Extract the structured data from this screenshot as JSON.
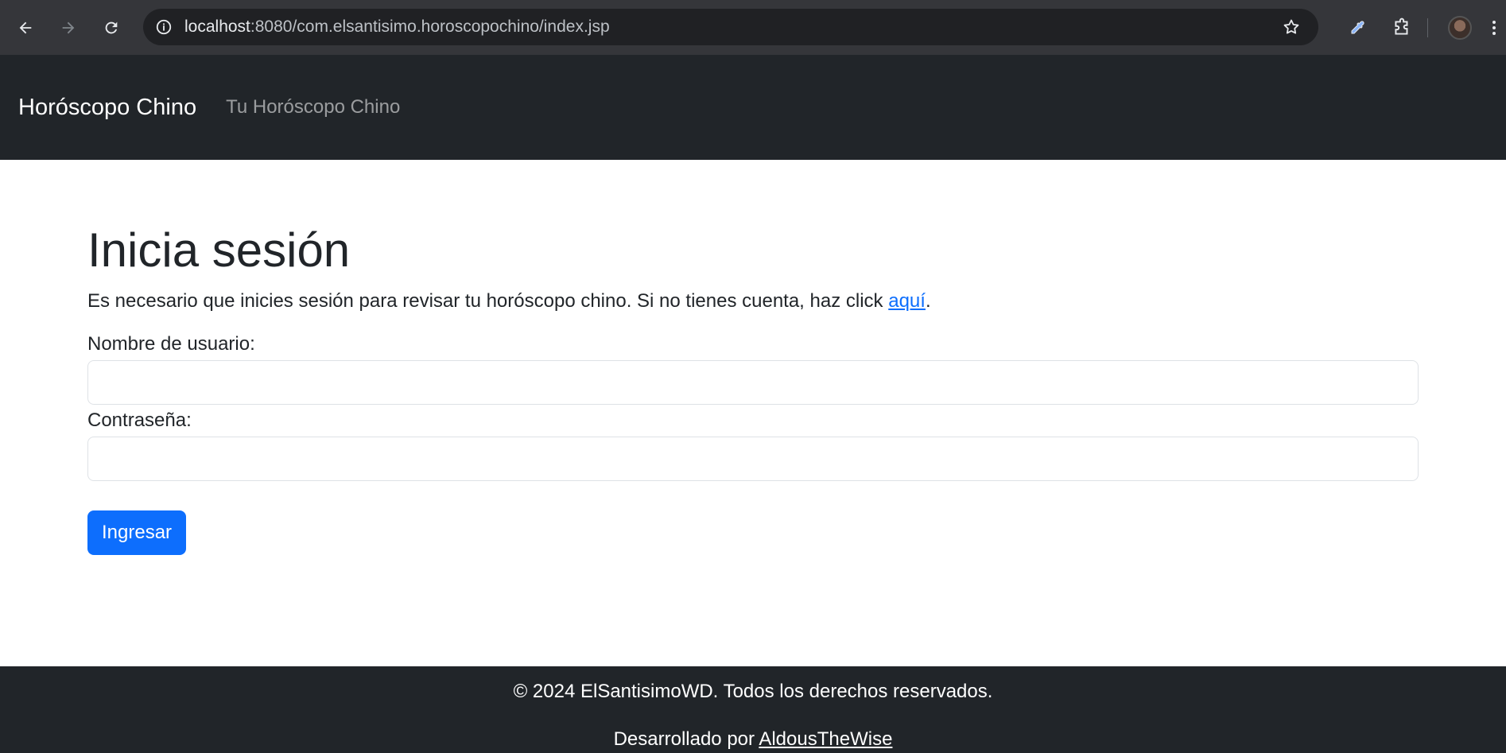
{
  "browser": {
    "url_host": "localhost",
    "url_path": ":8080/com.elsantisimo.horoscopochino/index.jsp",
    "icons": [
      "back-arrow-icon",
      "forward-arrow-icon",
      "reload-icon",
      "site-info-icon",
      "bookmark-star-icon",
      "eyedropper-icon",
      "extensions-puzzle-icon",
      "profile-avatar",
      "kebab-menu-icon"
    ]
  },
  "navbar": {
    "brand": "Horóscopo Chino",
    "link": "Tu Horóscopo Chino"
  },
  "main": {
    "title": "Inicia sesión",
    "lead_text": "Es necesario que inicies sesión para revisar tu horóscopo chino. Si no tienes cuenta, haz click ",
    "lead_link": "aquí",
    "lead_end": ".",
    "username_label": "Nombre de usuario:",
    "username_value": "",
    "password_label": "Contraseña:",
    "password_value": "",
    "submit_label": "Ingresar"
  },
  "footer": {
    "copyright": "© 2024 ElSantisimoWD. Todos los derechos reservados.",
    "dev_prefix": "Desarrollado por ",
    "dev_link": "AldousTheWise"
  },
  "colors": {
    "navbar_bg": "#212529",
    "primary": "#0d6efd",
    "chrome_bg": "#35363a"
  }
}
